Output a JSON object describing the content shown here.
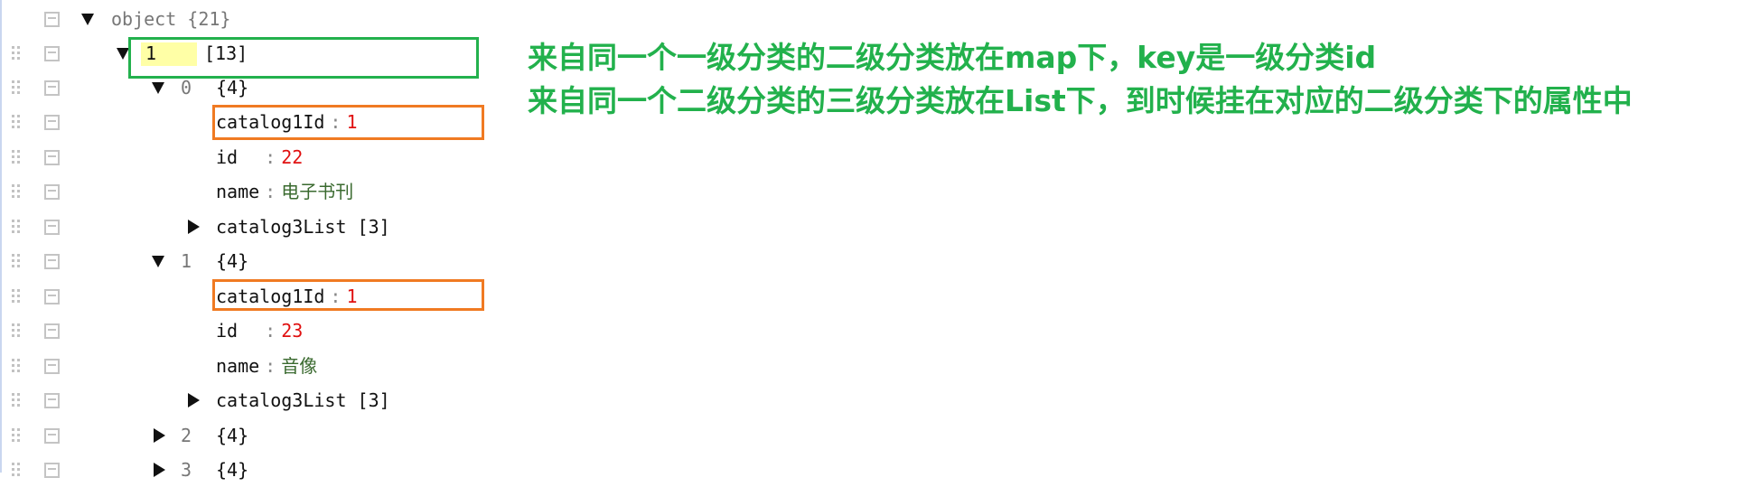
{
  "root": {
    "label": "object",
    "count": "{21}"
  },
  "group": {
    "key": "1",
    "count": "[13]"
  },
  "items": [
    {
      "index": "0",
      "count": "{4}",
      "catalog1Id": {
        "key": "catalog1Id",
        "sep": ":",
        "value": "1"
      },
      "id": {
        "key": "id  ",
        "sep": ":",
        "value": "22"
      },
      "name": {
        "key": "name",
        "sep": ":",
        "value": "电子书刊"
      },
      "list": {
        "key": "catalog3List",
        "count": "[3]"
      }
    },
    {
      "index": "1",
      "count": "{4}",
      "catalog1Id": {
        "key": "catalog1Id",
        "sep": ":",
        "value": "1"
      },
      "id": {
        "key": "id  ",
        "sep": ":",
        "value": "23"
      },
      "name": {
        "key": "name",
        "sep": ":",
        "value": "音像"
      },
      "list": {
        "key": "catalog3List",
        "count": "[3]"
      }
    }
  ],
  "collapsed": [
    {
      "index": "2",
      "count": "{4}"
    },
    {
      "index": "3",
      "count": "{4}"
    }
  ],
  "annotations": {
    "line1": "来自同一个一级分类的二级分类放在map下，key是一级分类id",
    "line2": "来自同一个二级分类的三级分类放在List下，到时候挂在对应的二级分类下的属性中"
  },
  "colors": {
    "annotation": "#22b14c",
    "group_box": "#23b14d",
    "highlight_box": "#f07a22",
    "number": "#e01010",
    "string": "#3a6a2f",
    "key_highlight": "#ffffa6"
  }
}
